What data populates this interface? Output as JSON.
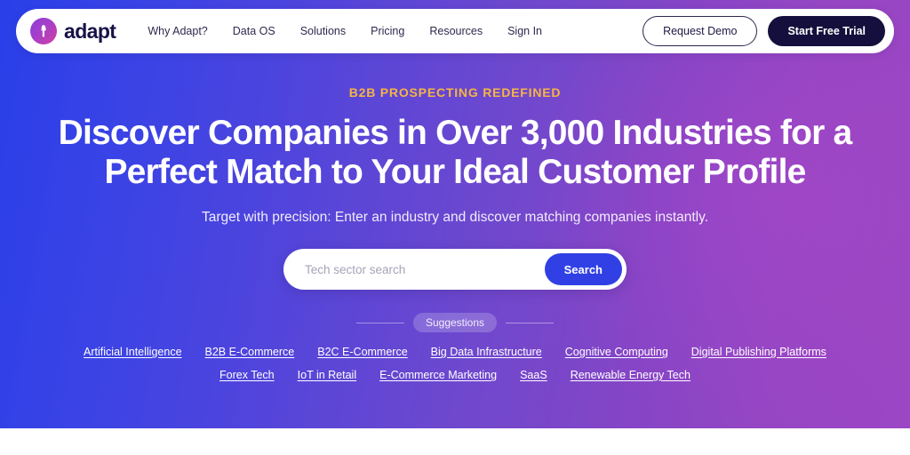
{
  "brand": {
    "name": "adapt",
    "logo_icon": "tree-starburst-icon",
    "gradient_from": "#8a3fd6",
    "gradient_to": "#d23fa0"
  },
  "nav": {
    "links": [
      {
        "label": "Why Adapt?"
      },
      {
        "label": "Data OS"
      },
      {
        "label": "Solutions"
      },
      {
        "label": "Pricing"
      },
      {
        "label": "Resources"
      },
      {
        "label": "Sign In"
      }
    ],
    "demo_button": "Request Demo",
    "trial_button": "Start Free Trial",
    "trial_bg": "#140f3c"
  },
  "hero": {
    "eyebrow": "B2B PROSPECTING REDEFINED",
    "eyebrow_color": "#f5b544",
    "headline_line1": "Discover Companies in Over 3,000 Industries for a",
    "headline_line2": "Perfect Match to Your Ideal Customer Profile",
    "subhead": "Target with precision: Enter an industry and discover matching companies instantly.",
    "gradient_left": "#2a3fe8",
    "gradient_right": "#9c46c4"
  },
  "search": {
    "placeholder": "Tech sector search",
    "value": "",
    "button_label": "Search",
    "button_color": "#3040e4",
    "icon": "search-icon"
  },
  "suggestions": {
    "divider_label": "Suggestions",
    "row1": [
      {
        "label": "Artificial Intelligence"
      },
      {
        "label": "B2B E-Commerce"
      },
      {
        "label": "B2C E-Commerce"
      },
      {
        "label": "Big Data Infrastructure"
      },
      {
        "label": "Cognitive Computing"
      },
      {
        "label": "Digital Publishing Platforms"
      }
    ],
    "row2": [
      {
        "label": "Forex Tech"
      },
      {
        "label": "IoT in Retail"
      },
      {
        "label": "E-Commerce Marketing"
      },
      {
        "label": "SaaS"
      },
      {
        "label": "Renewable Energy Tech"
      }
    ]
  }
}
